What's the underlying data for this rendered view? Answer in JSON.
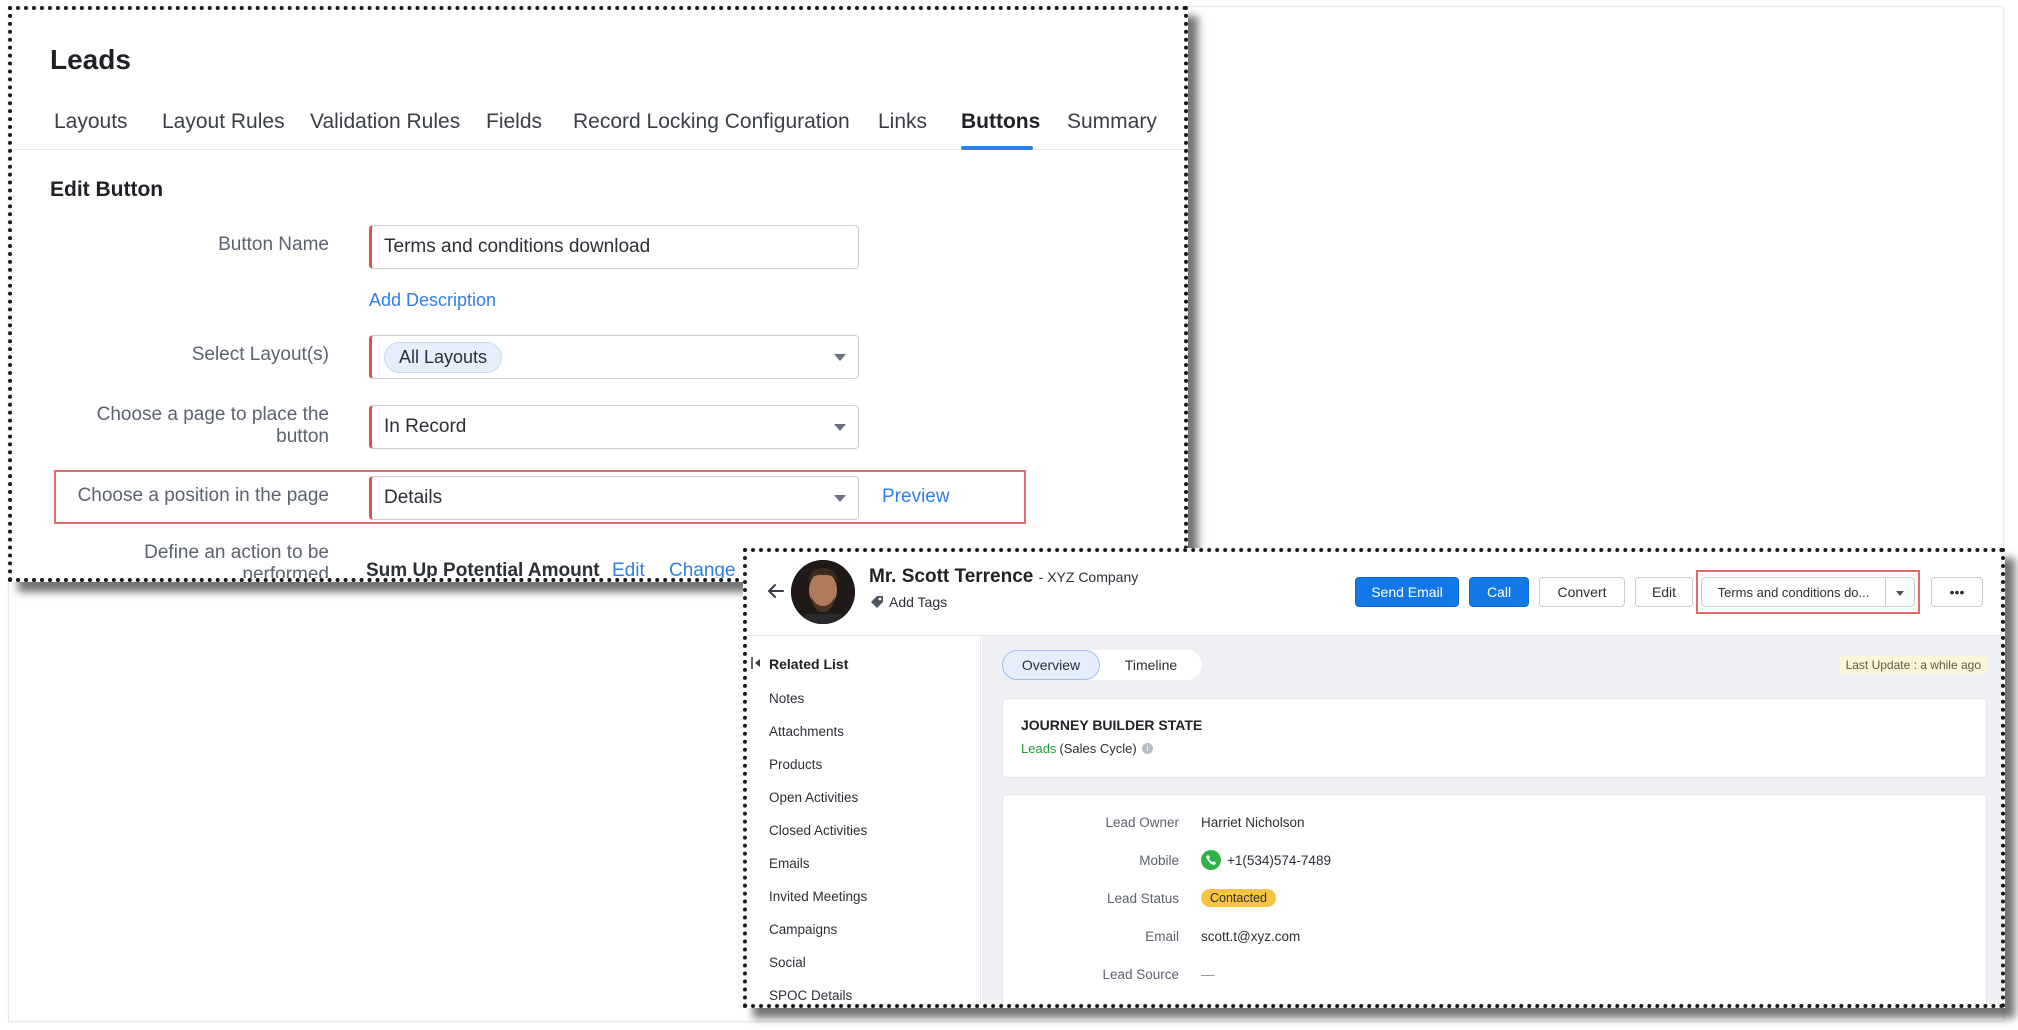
{
  "settings": {
    "module_title": "Leads",
    "tabs": [
      {
        "label": "Layouts"
      },
      {
        "label": "Layout Rules"
      },
      {
        "label": "Validation Rules"
      },
      {
        "label": "Fields"
      },
      {
        "label": "Record Locking Configuration"
      },
      {
        "label": "Links"
      },
      {
        "label": "Buttons",
        "active": true
      },
      {
        "label": "Summary"
      }
    ],
    "section_title": "Edit Button",
    "form": {
      "button_name_label": "Button Name",
      "button_name_value": "Terms and conditions download",
      "add_description_link": "Add Description",
      "layouts_label": "Select Layout(s)",
      "layouts_chip": "All Layouts",
      "page_label": "Choose a page to place the button",
      "page_value": "In Record",
      "position_label": "Choose a position in the page",
      "position_value": "Details",
      "preview_link": "Preview",
      "action_label": "Define an action to be performed",
      "action_value": "Sum Up Potential Amount",
      "edit_link": "Edit",
      "change_link": "Change"
    }
  },
  "record": {
    "name": "Mr. Scott Terrence",
    "company": "- XYZ Company",
    "add_tags": "Add Tags",
    "buttons": {
      "send_email": "Send Email",
      "call": "Call",
      "convert": "Convert",
      "edit": "Edit",
      "custom": "Terms and conditions do...",
      "more": "•••"
    },
    "related_list_title": "Related List",
    "related_list": [
      "Notes",
      "Attachments",
      "Products",
      "Open Activities",
      "Closed Activities",
      "Emails",
      "Invited Meetings",
      "Campaigns",
      "Social",
      "SPOC Details"
    ],
    "view_tabs": [
      "Overview",
      "Timeline"
    ],
    "last_update": "Last Update : a while ago",
    "journey": {
      "title": "JOURNEY BUILDER STATE",
      "stage": "Leads",
      "cycle": "(Sales Cycle)",
      "info_glyph": "i"
    },
    "fields": [
      {
        "label": "Lead Owner",
        "value": "Harriet Nicholson"
      },
      {
        "label": "Mobile",
        "value": "+1(534)574-7489"
      },
      {
        "label": "Lead Status",
        "value": "Contacted"
      },
      {
        "label": "Email",
        "value": "scott.t@xyz.com"
      },
      {
        "label": "Lead Source",
        "value": "—"
      }
    ],
    "colors": {
      "primary": "#1278e8",
      "status_badge": "#f6c343",
      "link": "#2f7fe6",
      "highlight": "#e36b6b"
    }
  }
}
